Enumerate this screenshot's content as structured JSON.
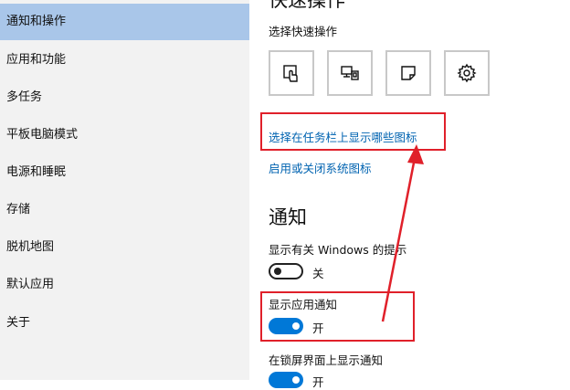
{
  "sidebar": {
    "items": [
      {
        "label": "通知和操作",
        "selected": true
      },
      {
        "label": "应用和功能"
      },
      {
        "label": "多任务"
      },
      {
        "label": "平板电脑模式"
      },
      {
        "label": "电源和睡眠"
      },
      {
        "label": "存储"
      },
      {
        "label": "脱机地图"
      },
      {
        "label": "默认应用"
      },
      {
        "label": "关于"
      }
    ]
  },
  "quick_actions": {
    "title": "快速操作",
    "subtitle": "选择快速操作",
    "tiles": [
      {
        "icon": "tablet-mode-icon"
      },
      {
        "icon": "project-icon"
      },
      {
        "icon": "note-icon"
      },
      {
        "icon": "gear-icon"
      }
    ],
    "link_taskbar_icons": "选择在任务栏上显示哪些图标",
    "link_system_icons": "启用或关闭系统图标"
  },
  "notifications": {
    "title": "通知",
    "tips": {
      "label": "显示有关 Windows 的提示",
      "state": "关",
      "on": false
    },
    "app_notifications": {
      "label": "显示应用通知",
      "state": "开",
      "on": true
    },
    "lock_screen": {
      "label": "在锁屏界面上显示通知",
      "state": "开",
      "on": true
    }
  },
  "colors": {
    "accent": "#0078d7",
    "link": "#0063b1",
    "selection": "#a9c6e9",
    "annotation": "#e0202a"
  }
}
